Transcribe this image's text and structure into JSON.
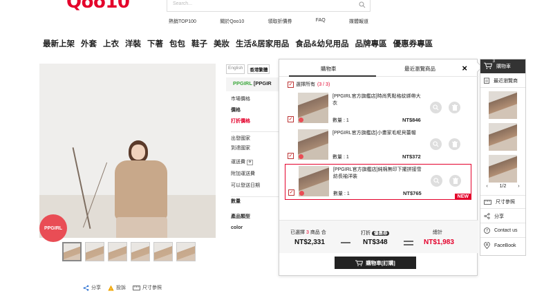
{
  "header": {
    "logo": "Qoo10",
    "search_placeholder": "Search...",
    "top_links": [
      "熱銷TOP100",
      "關於Qoo10",
      "領取折價券",
      "FAQ",
      "媒體報道"
    ]
  },
  "category_nav": [
    "最新上架",
    "外套",
    "上衣",
    "洋裝",
    "下著",
    "包包",
    "鞋子",
    "美妝",
    "生活&居家用品",
    "食品&幼兒用品",
    "品牌專區",
    "優惠券專區"
  ],
  "product": {
    "badge": "PPGIRL",
    "languages": [
      "English",
      "香港繁體"
    ],
    "brand": "PPGIRL",
    "brand_title": "[PPGIR",
    "labels": {
      "market_price": "市場價格",
      "price": "價格",
      "discount_price": "打折價格",
      "ship_from": "出發國家",
      "ship_to": "到達國家",
      "shipping_fee": "運送費",
      "extra_fee": "附加運送費",
      "ship_date": "可以發送日期",
      "quantity": "數量",
      "category": "產品類型",
      "color": "color"
    },
    "share_bar": [
      "分享",
      "投訴",
      "尺寸參照"
    ]
  },
  "cart_popup": {
    "tabs": [
      "購物車",
      "最近瀏覽商品"
    ],
    "close": "×",
    "select_all_label": "選擇所有",
    "select_all_count": "(3 / 3)",
    "items": [
      {
        "title": "[PPGIRL官方旗艦店]時尚隽點格紋綁帶大衣",
        "qty": "數量 : 1",
        "price": "NT$846",
        "highlight": false,
        "new": ""
      },
      {
        "title": "[PPGIRL官方旗艦店]小畫家毛呢貝蕾帽",
        "qty": "數量 : 1",
        "price": "NT$372",
        "highlight": false,
        "new": ""
      },
      {
        "title": "[PPGIRL官方旗艦店]純棉無印下擺拼接雪紡長袖洋裝",
        "qty": "數量 : 1",
        "price": "NT$765",
        "highlight": true,
        "new": "NEW"
      }
    ],
    "summary": {
      "selected_prefix": "已選擇",
      "selected_count": "3",
      "selected_suffix": "商品 合",
      "subtotal": "NT$2,331",
      "discount_label": "打折",
      "coupon_tag": "優惠券",
      "discount": "NT$348",
      "total_label": "總計",
      "total": "NT$1,983"
    },
    "checkout_label": "購物車[訂購]"
  },
  "sidebar": {
    "cart_label": "購物車",
    "cart_count": "3",
    "recent_label": "最近瀏覽商",
    "page": "1/2",
    "prev": "‹",
    "next": "›",
    "links": [
      "尺寸參照",
      "分享",
      "Contact us",
      "FaceBook"
    ]
  },
  "colors": {
    "brand_red": "#e4002b",
    "brand_green": "#3da83d",
    "dark": "#222222"
  }
}
